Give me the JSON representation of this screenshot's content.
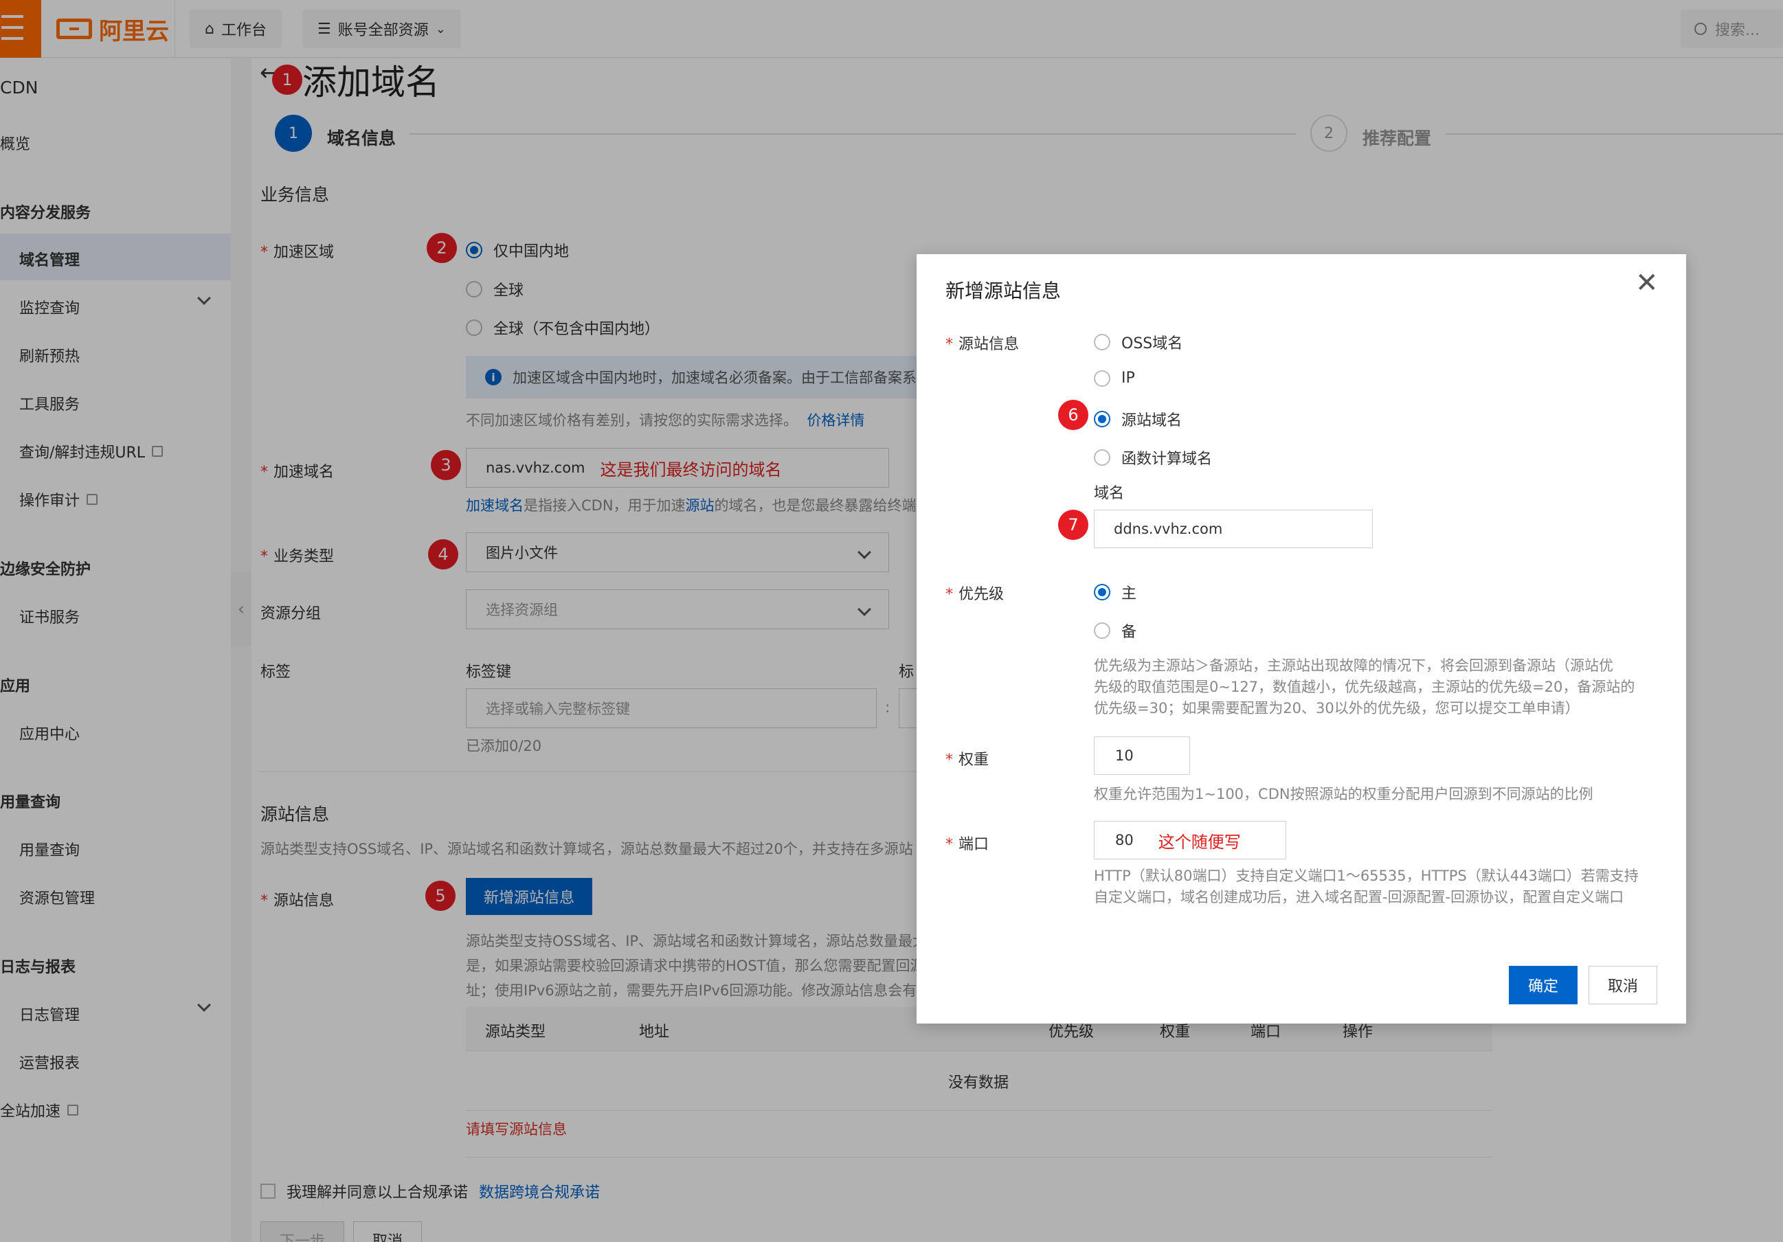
{
  "topbar": {
    "logo_text": "阿里云",
    "workbench": "工作台",
    "resources": "账号全部资源",
    "search_placeholder": "搜索..."
  },
  "sidebar": {
    "product": "CDN",
    "overview": "概览",
    "groups": {
      "content": "内容分发服务",
      "edge": "边缘安全防护",
      "app": "应用",
      "usage": "用量查询",
      "logs": "日志与报表"
    },
    "items": [
      "域名管理",
      "监控查询",
      "刷新预热",
      "工具服务",
      "查询/解封违规URL",
      "操作审计",
      "证书服务",
      "应用中心",
      "用量查询",
      "资源包管理",
      "日志管理",
      "运营报表",
      "全站加速"
    ]
  },
  "page": {
    "title": "添加域名",
    "steps": [
      {
        "num": "1",
        "label": "域名信息"
      },
      {
        "num": "2",
        "label": "推荐配置"
      }
    ],
    "section_business": "业务信息",
    "accel_region": {
      "label": "加速区域",
      "options": [
        "仅中国内地",
        "全球",
        "全球（不包含中国内地）"
      ],
      "selected": 0,
      "notice": "加速区域含中国内地时，加速域名必须备案。由于工信部备案系",
      "hint": "不同加速区域价格有差别，请按您的实际需求选择。",
      "price_link": "价格详情"
    },
    "domain": {
      "label": "加速域名",
      "value": "nas.vvhz.com",
      "annotation": "这是我们最终访问的域名",
      "help_link1": "加速域名",
      "help_text1": "是指接入CDN，用于加速",
      "help_link2": "源站",
      "help_text2": "的域名，也是您最终暴露给终端"
    },
    "biz_type": {
      "label": "业务类型",
      "value": "图片小文件"
    },
    "resource_group": {
      "label": "资源分组",
      "placeholder": "选择资源组"
    },
    "tags": {
      "label": "标签",
      "key_header": "标签键",
      "value_header": "标",
      "key_placeholder": "选择或输入完整标签键",
      "count": "已添加0/20"
    },
    "section_origin": "源站信息",
    "origin_desc": "源站类型支持OSS域名、IP、源站域名和函数计算域名，源站总数量最大不超过20个，并支持在多源站",
    "origin": {
      "label": "源站信息",
      "add_button": "新增源站信息",
      "desc_lines": [
        "源站类型支持OSS域名、IP、源站域名和函数计算域名，源站总数量最大",
        "是，如果源站需要校验回源请求中携带的HOST值，那么您需要配置回源",
        "址；使用IPv6源站之前，需要先开启IPv6回源功能。修改源站信息会有3"
      ],
      "table_headers": [
        "源站类型",
        "地址",
        "优先级",
        "权重",
        "端口",
        "操作"
      ],
      "empty": "没有数据",
      "error": "请填写源站信息"
    },
    "agree": {
      "text": "我理解并同意以上合规承诺",
      "link": "数据跨境合规承诺"
    },
    "buttons": {
      "next": "下一步",
      "cancel": "取消"
    }
  },
  "dialog": {
    "title": "新增源站信息",
    "origin_label": "源站信息",
    "origin_options": [
      "OSS域名",
      "IP",
      "源站域名",
      "函数计算域名"
    ],
    "origin_selected": 2,
    "domain_label": "域名",
    "domain_value": "ddns.vvhz.com",
    "priority_label": "优先级",
    "priority_options": [
      "主",
      "备"
    ],
    "priority_selected": 0,
    "priority_help": [
      "优先级为主源站＞备源站，主源站出现故障的情况下，将会回源到备源站（源站优",
      "先级的取值范围是0~127，数值越小，优先级越高，主源站的优先级=20，备源站的",
      "优先级=30；如果需要配置为20、30以外的优先级，您可以提交工单申请）"
    ],
    "weight_label": "权重",
    "weight_value": "10",
    "weight_help": "权重允许范围为1~100，CDN按照源站的权重分配用户回源到不同源站的比例",
    "port_label": "端口",
    "port_value": "80",
    "port_annotation": "这个随便写",
    "port_help": [
      "HTTP（默认80端口）支持自定义端口1～65535，HTTPS（默认443端口）若需支持",
      "自定义端口，域名创建成功后，进入域名配置-回源配置-回源协议，配置自定义端口"
    ],
    "confirm": "确定",
    "cancel": "取消"
  },
  "badges": [
    "1",
    "2",
    "3",
    "4",
    "5",
    "6",
    "7"
  ],
  "colors": {
    "accent": "#0064c8",
    "brand": "#ff6a00",
    "badge": "#e51c23",
    "annotation": "#e02020"
  }
}
